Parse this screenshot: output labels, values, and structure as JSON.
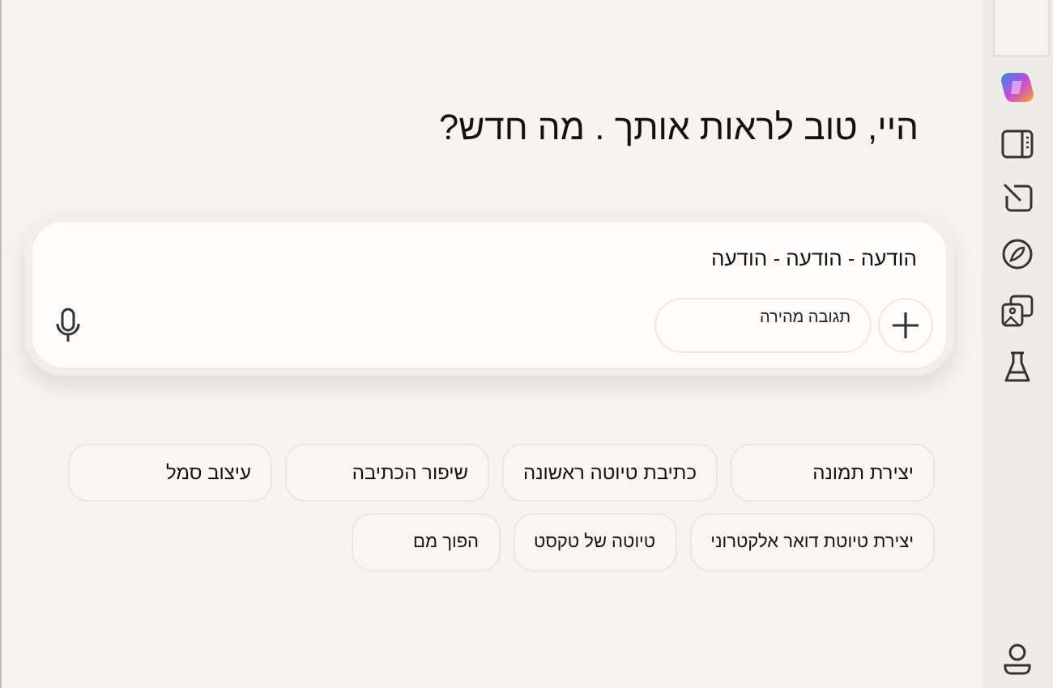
{
  "greeting": "היי, טוב לראות אותך . מה חדש?",
  "composer": {
    "value": "הודעה - הודעה - הודעה",
    "mode_button": "תגובה מהירה"
  },
  "suggestions": [
    [
      "יצירת תמונה",
      "כתיבת טיוטה ראשונה",
      "שיפור הכתיבה",
      "עיצוב סמל"
    ],
    [
      "יצירת טיוטת דואר אלקטרוני",
      "טיוטה של טקסט",
      "הפוך מם"
    ]
  ],
  "sidebar": {
    "items": [
      {
        "kind": "logo"
      },
      {
        "kind": "panel"
      },
      {
        "kind": "compose"
      },
      {
        "kind": "compass"
      },
      {
        "kind": "images"
      },
      {
        "kind": "flask"
      }
    ]
  }
}
